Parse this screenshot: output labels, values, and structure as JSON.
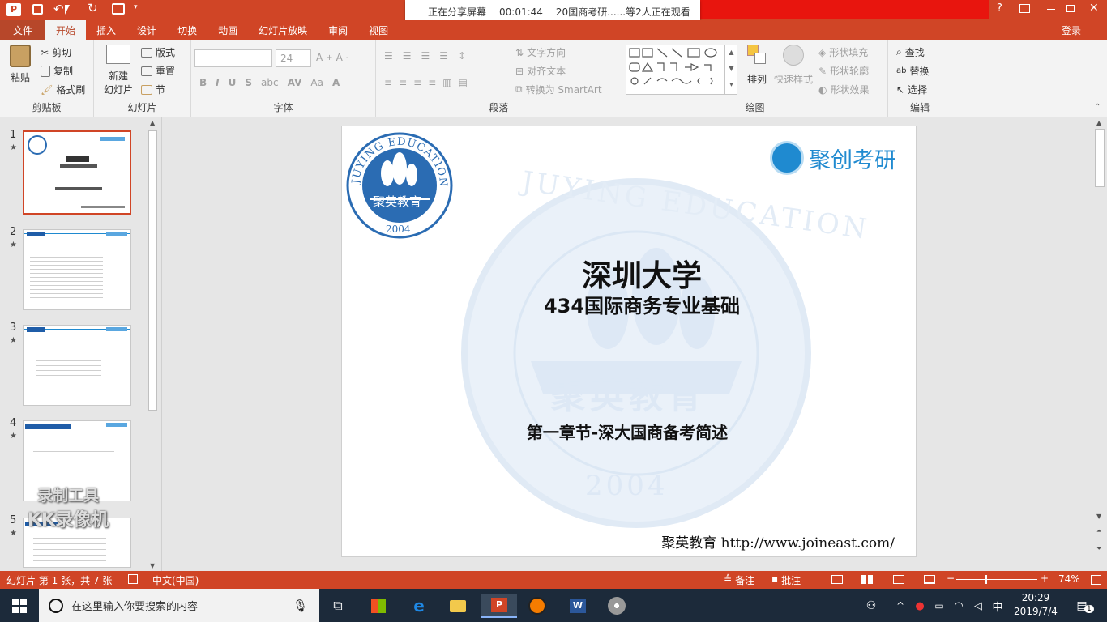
{
  "titlebar": {
    "share_status": "正在分享屏幕",
    "share_timer": "00:01:44",
    "share_viewers": "20国商考研......等2人正在观看",
    "help": "?"
  },
  "tabs": [
    "文件",
    "开始",
    "插入",
    "设计",
    "切换",
    "动画",
    "幻灯片放映",
    "审阅",
    "视图"
  ],
  "active_tab": "开始",
  "login": "登录",
  "ribbon": {
    "clipboard": {
      "label": "剪贴板",
      "paste": "粘贴",
      "cut": "剪切",
      "copy": "复制",
      "format_painter": "格式刷"
    },
    "slides": {
      "label": "幻灯片",
      "new_slide": "新建",
      "new_slide2": "幻灯片",
      "layout": "版式",
      "reset": "重置",
      "section": "节"
    },
    "font": {
      "label": "字体",
      "size": "24"
    },
    "paragraph": {
      "label": "段落",
      "text_direction": "文字方向",
      "align_text": "对齐文本",
      "smartart": "转换为 SmartArt"
    },
    "drawing": {
      "label": "绘图",
      "arrange": "排列",
      "quick_styles": "快速样式",
      "fill": "形状填充",
      "outline": "形状轮廓",
      "effects": "形状效果"
    },
    "editing": {
      "label": "编辑",
      "find": "查找",
      "replace": "替换",
      "select": "选择"
    }
  },
  "thumbnails": [
    "1",
    "2",
    "3",
    "4",
    "5"
  ],
  "watermark": {
    "line1": "录制工具",
    "line2": "KK录像机"
  },
  "slide": {
    "logo_text_top": "JUYING EDUCATION",
    "logo_text_center": "聚英教育",
    "logo_year": "2004",
    "brand": "聚创考研",
    "title": "深圳大学",
    "subtitle": "434国际商务专业基础",
    "chapter": "第一章节-深大国商备考简述",
    "footer": "聚英教育 http://www.joineast.com/"
  },
  "statusbar": {
    "slide_info": "幻灯片 第 1 张，共 7 张",
    "language": "中文(中国)",
    "notes": "备注",
    "comments": "批注",
    "zoom": "74%"
  },
  "taskbar": {
    "search_placeholder": "在这里输入你要搜索的内容",
    "ime": "中",
    "time": "20:29",
    "date": "2019/7/4",
    "notif_count": "1"
  },
  "colors": {
    "accent": "#d04526",
    "brand_blue": "#1f8ad0",
    "logo_blue": "#2b6cb3"
  }
}
